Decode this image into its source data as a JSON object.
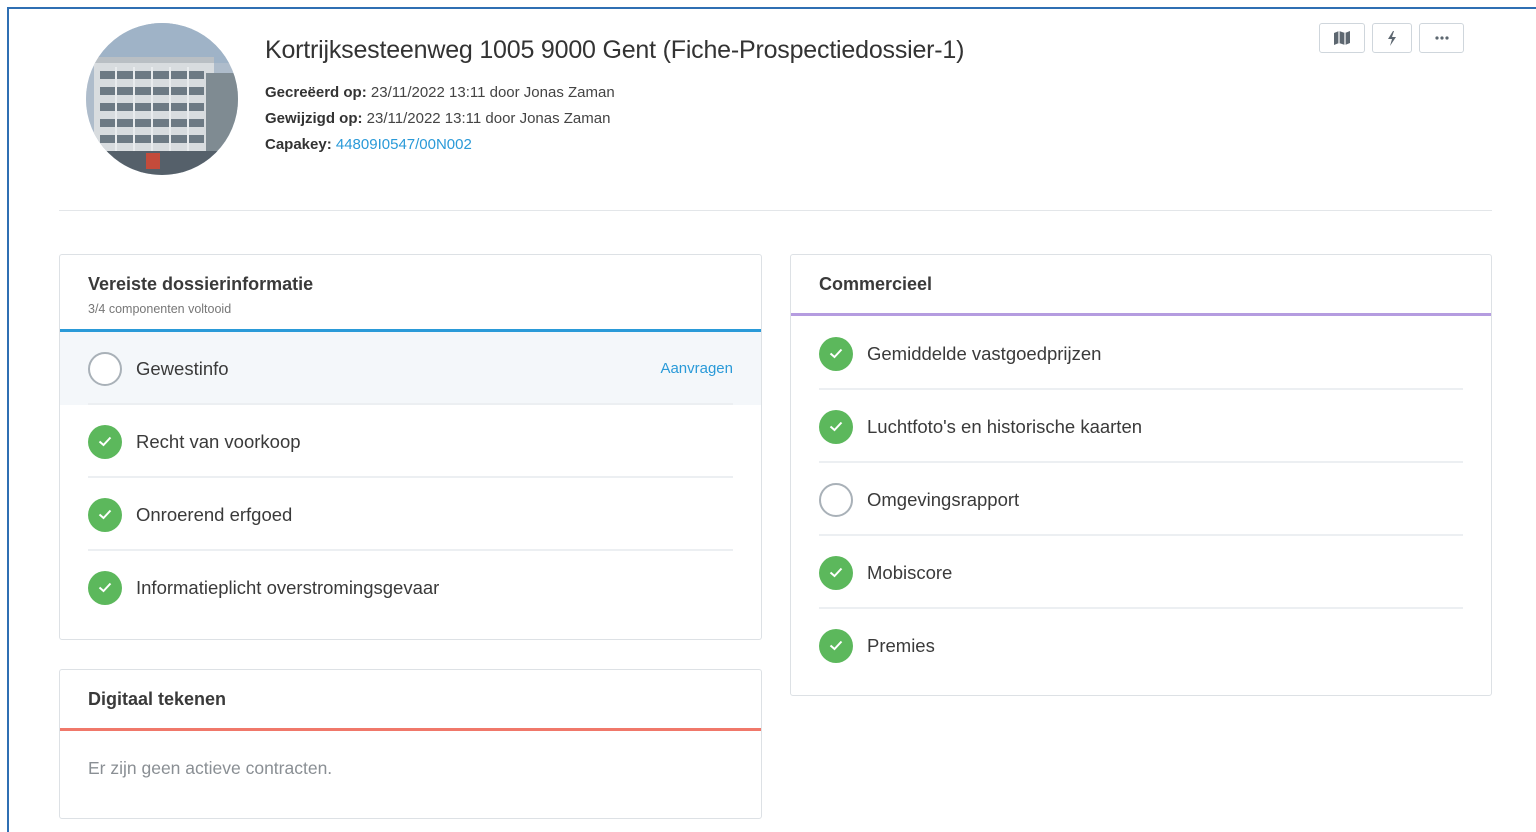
{
  "header": {
    "title": "Kortrijksesteenweg 1005 9000 Gent (Fiche-Prospectiedossier-1)",
    "created_label": "Gecreëerd op:",
    "created_value": "23/11/2022 13:11 door Jonas Zaman",
    "modified_label": "Gewijzigd op:",
    "modified_value": "23/11/2022 13:11 door Jonas Zaman",
    "capakey_label": "Capakey:",
    "capakey_value": "44809I0547/00N002",
    "actions": [
      {
        "icon": "map-icon"
      },
      {
        "icon": "bolt-icon"
      },
      {
        "icon": "more-icon"
      }
    ]
  },
  "required": {
    "title": "Vereiste dossierinformatie",
    "subtitle": "3/4 componenten voltooid",
    "accent": "#2a9ad8",
    "items": [
      {
        "label": "Gewestinfo",
        "done": false,
        "action": "Aanvragen"
      },
      {
        "label": "Recht van voorkoop",
        "done": true
      },
      {
        "label": "Onroerend erfgoed",
        "done": true
      },
      {
        "label": "Informatieplicht overstromingsgevaar",
        "done": true
      }
    ]
  },
  "commercial": {
    "title": "Commercieel",
    "accent": "#b59ce0",
    "items": [
      {
        "label": "Gemiddelde vastgoedprijzen",
        "done": true
      },
      {
        "label": "Luchtfoto's en historische kaarten",
        "done": true
      },
      {
        "label": "Omgevingsrapport",
        "done": false
      },
      {
        "label": "Mobiscore",
        "done": true
      },
      {
        "label": "Premies",
        "done": true
      }
    ]
  },
  "signing": {
    "title": "Digitaal tekenen",
    "accent": "#f0786a",
    "empty_text": "Er zijn geen actieve contracten."
  },
  "colors": {
    "done": "#5cb85c",
    "link": "#2a9ad8",
    "frame": "#2f6fb3"
  }
}
